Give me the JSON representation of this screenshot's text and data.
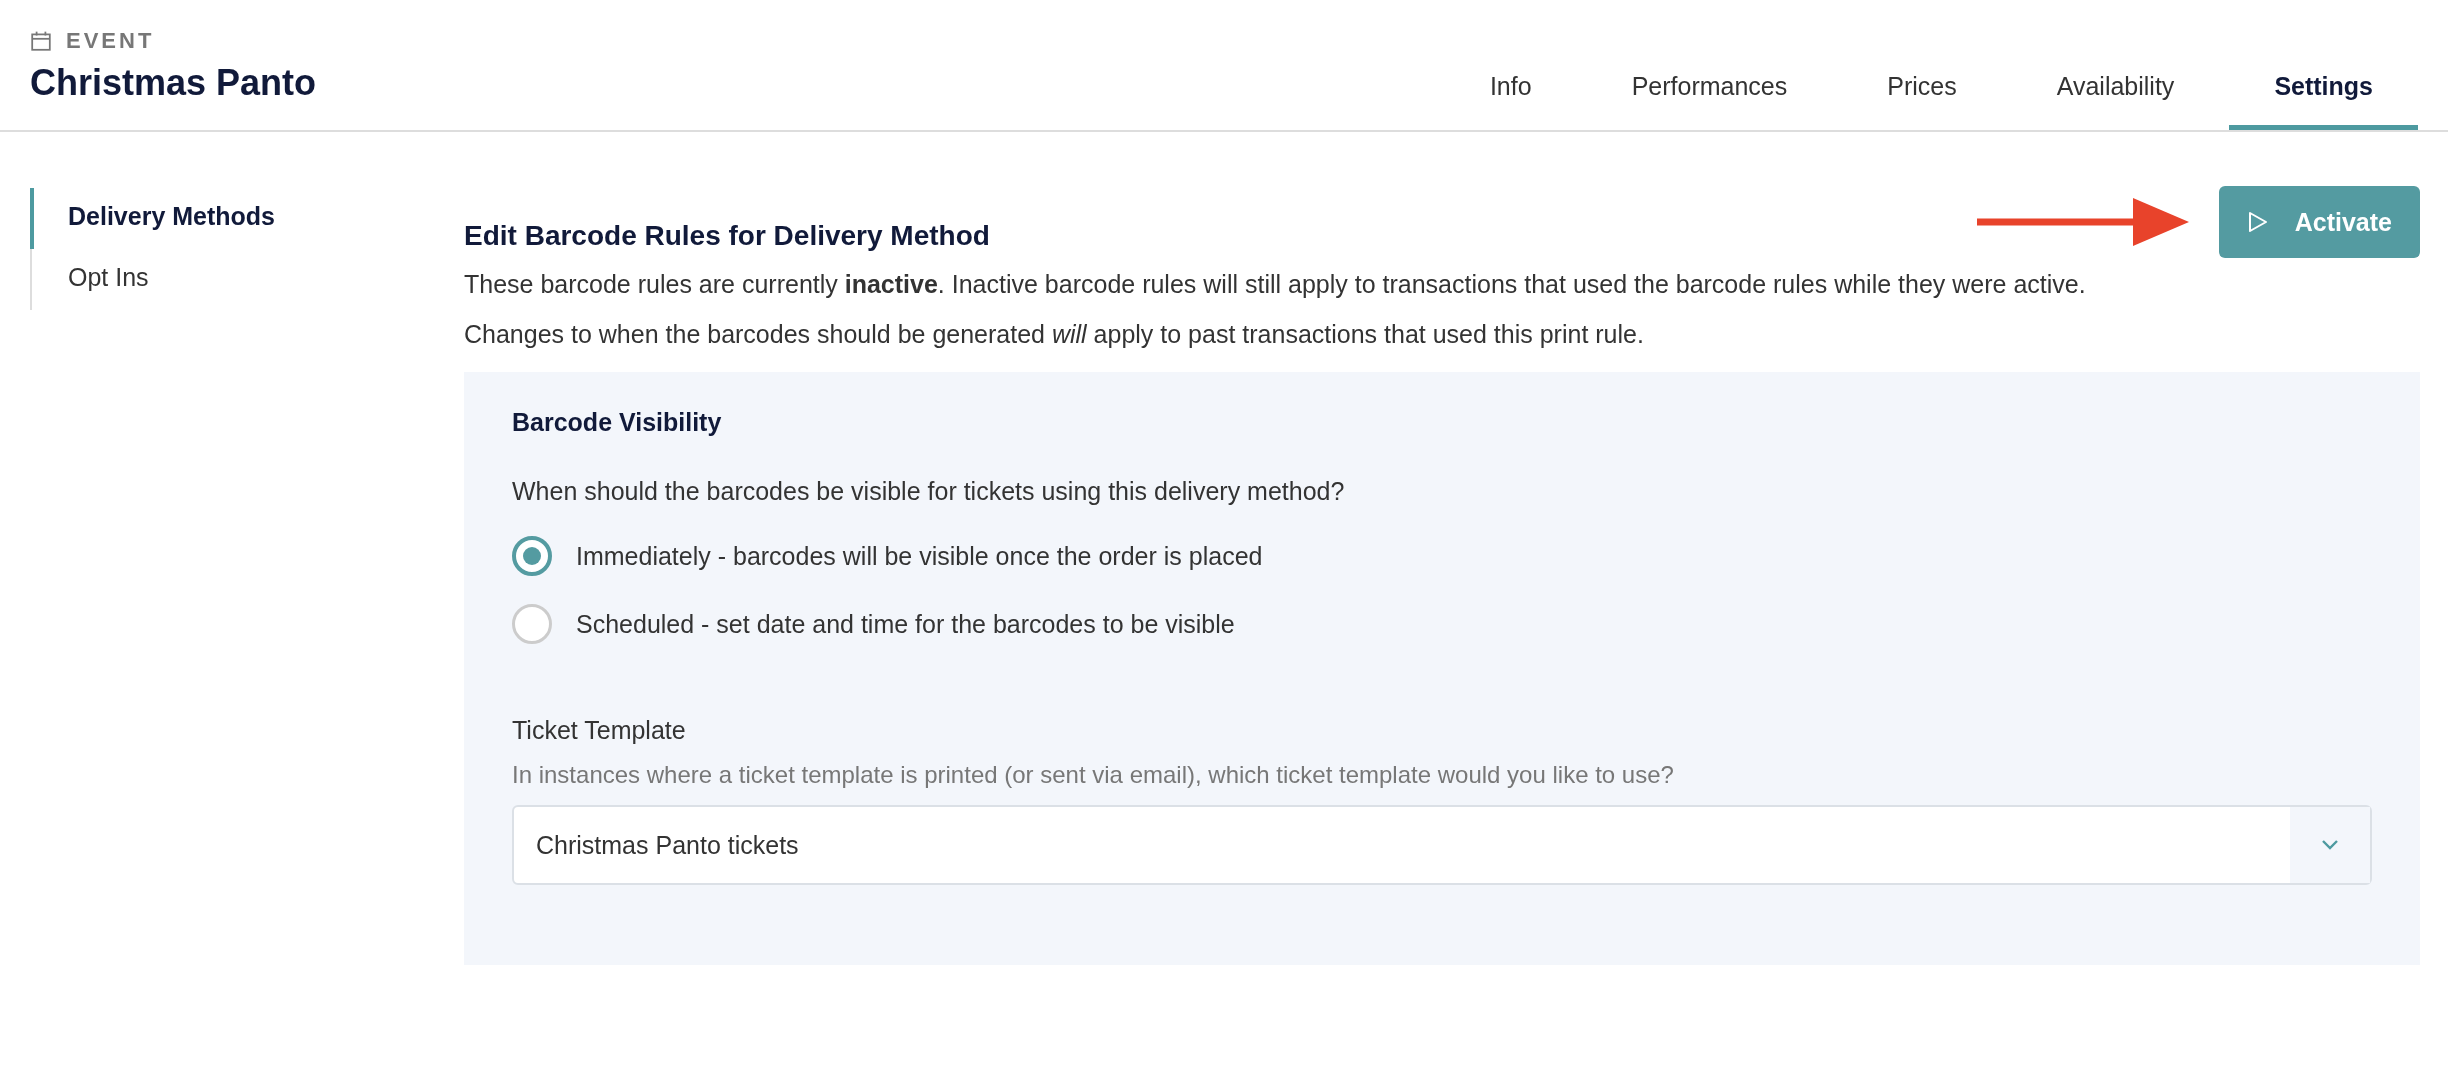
{
  "header": {
    "label": "EVENT",
    "title": "Christmas Panto"
  },
  "tabs": [
    {
      "label": "Info",
      "selected": false
    },
    {
      "label": "Performances",
      "selected": false
    },
    {
      "label": "Prices",
      "selected": false
    },
    {
      "label": "Availability",
      "selected": false
    },
    {
      "label": "Settings",
      "selected": true
    }
  ],
  "sidebar": {
    "items": [
      {
        "label": "Delivery Methods",
        "selected": true
      },
      {
        "label": "Opt Ins",
        "selected": false
      }
    ]
  },
  "main": {
    "heading": "Edit Barcode Rules for Delivery Method",
    "action_button": "Activate",
    "paragraphs": [
      "These barcode rules are currently **inactive**. Inactive barcode rules will still apply to transactions that used the barcode rules while they were active.",
      "Changes to when the barcodes should be generated *will* apply to past transactions that used this print rule."
    ],
    "visibility": {
      "title": "Barcode Visibility",
      "question": "When should the barcodes be visible for tickets using this delivery method?",
      "options": [
        {
          "label": "Immediately - barcodes will be visible once the order is placed",
          "selected": true
        },
        {
          "label": "Scheduled - set date and time for the barcodes to be visible",
          "selected": false
        }
      ]
    },
    "ticket_template": {
      "label": "Ticket Template",
      "hint": "In instances where a ticket template is printed (or sent via email), which ticket template would you like to use?",
      "value": "Christmas Panto tickets"
    }
  }
}
